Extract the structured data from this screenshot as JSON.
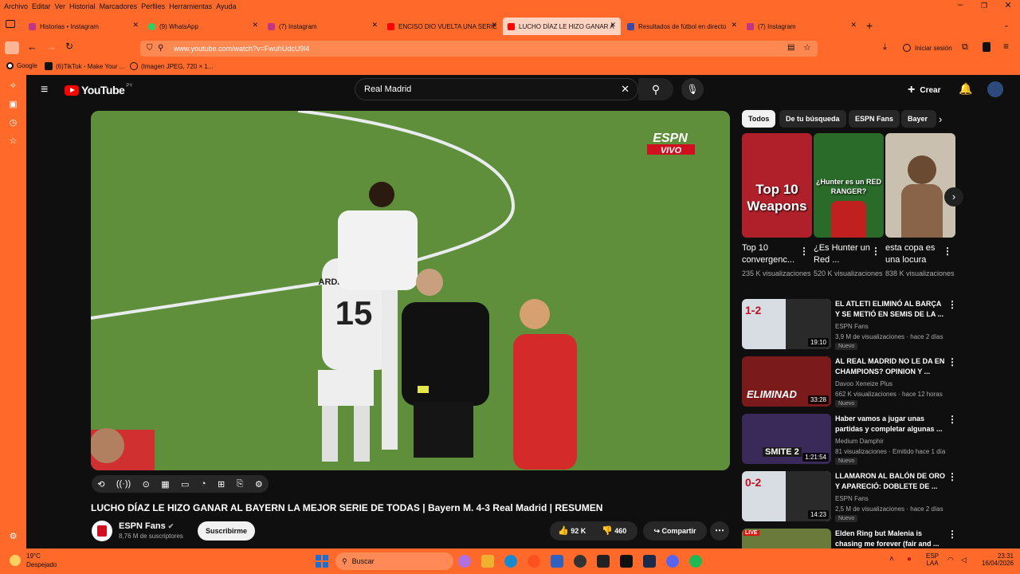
{
  "menubar": {
    "items": [
      "Archivo",
      "Editar",
      "Ver",
      "Historial",
      "Marcadores",
      "Perfiles",
      "Herramientas",
      "Ayuda"
    ]
  },
  "tabs": [
    {
      "label": "Historias • Instagram",
      "color": "#c13584"
    },
    {
      "label": "(9) WhatsApp",
      "color": "#25d366"
    },
    {
      "label": "(7) Instagram",
      "color": "#c13584"
    },
    {
      "label": "ENCISO DIO VUELTA UNA SERIE",
      "color": "#ff0000"
    },
    {
      "label": "LUCHO DÍAZ LE HIZO GANAR A",
      "color": "#ff0000"
    },
    {
      "label": "Resultados de fútbol en directo",
      "color": "#3949ab"
    },
    {
      "label": "(7) Instagram",
      "color": "#c13584"
    }
  ],
  "address": {
    "url": "www.youtube.com/watch?v=FwuhUdcU9l4",
    "signin": "Iniciar sesión"
  },
  "bookmarks": [
    {
      "label": "Google"
    },
    {
      "label": "(6)TikTok - Make Your ..."
    },
    {
      "label": "(Imagen JPEG, 720 × 1..."
    }
  ],
  "youtube": {
    "logo": "YouTube",
    "country": "PY",
    "search_value": "Real Madrid",
    "create_label": "Crear",
    "video": {
      "overlay_brand": "ESPN",
      "overlay_live": "VIVO",
      "player_name": "ARDA GÜLER",
      "player_number": "15",
      "title": "LUCHO DÍAZ LE HIZO GANAR AL BAYERN LA MEJOR SERIE DE TODAS | Bayern M. 4-3 Real Madrid | RESUMEN"
    },
    "channel": {
      "name": "ESPN Fans",
      "subs": "8,76 M de suscriptores",
      "subscribe": "Suscribirme"
    },
    "actions": {
      "likes": "92 K",
      "dislikes": "460",
      "share": "Compartir"
    },
    "chips": [
      "Todos",
      "De tu búsqueda",
      "ESPN Fans",
      "Bayer"
    ],
    "shorts": [
      {
        "title": "Top 10 convergenc...",
        "views": "235 K visualizaciones",
        "overlay": "Top 10 Weapons",
        "bg": "#b0202a"
      },
      {
        "title": "¿Es Hunter un Red ...",
        "views": "520 K visualizaciones",
        "overlay": "¿Hunter es un RED RANGER?",
        "bg": "#2a6b2a"
      },
      {
        "title": "esta copa es una locura",
        "views": "838 K visualizaciones",
        "overlay": "",
        "bg": "#c9c0b0"
      }
    ],
    "recs": [
      {
        "title": "EL ATLETI ELIMINÓ AL BARÇA Y SE METIÓ EN SEMIS DE LA ...",
        "channel": "ESPN Fans",
        "meta": "3,9 M de visualizaciones · hace 2 días",
        "badge": "Nuevo",
        "duration": "19:10",
        "overlay": "1-2",
        "bg": "#d8dde3"
      },
      {
        "title": "AL REAL MADRID NO LE DA EN CHAMPIONS? OPINION Y ...",
        "channel": "Davoo Xeneize Plus",
        "meta": "662 K visualizaciones · hace 12 horas",
        "badge": "Nuevo",
        "duration": "33:28",
        "overlay": "ELIMINAD",
        "bg": "#7a1a1a"
      },
      {
        "title": "Haber vamos a jugar unas partidas y completar algunas ...",
        "channel": "Medium Damphir",
        "meta": "81 visualizaciones · Emitido hace 1 día",
        "badge": "Nuevo",
        "duration": "1:21:54",
        "overlay": "SMITE 2",
        "bg": "#3a2a5a"
      },
      {
        "title": "LLAMARON AL BALÓN DE ORO Y APARECIÓ: DOBLETE DE ...",
        "channel": "ESPN Fans",
        "meta": "2,5 M de visualizaciones · hace 2 días",
        "badge": "Nuevo",
        "duration": "14:23",
        "overlay": "0-2",
        "bg": "#d8dde3"
      },
      {
        "title": "Elden Ring but Malenia is chasing me forever (fair and ...",
        "channel": "",
        "meta": "",
        "badge": "",
        "duration": "",
        "overlay": "LIVE",
        "bg": "#6a7a3a"
      }
    ]
  },
  "taskbar": {
    "weather_temp": "19°C",
    "weather_desc": "Despejado",
    "search": "Buscar",
    "lang": "ESP",
    "layout": "LAA",
    "time": "23:31",
    "date": "16/04/2026"
  },
  "colors": {
    "browser": "#ff6a2b",
    "yt_bg": "#0f0f0f",
    "yt_red": "#ff0000",
    "pitch": "#5a8a35"
  }
}
